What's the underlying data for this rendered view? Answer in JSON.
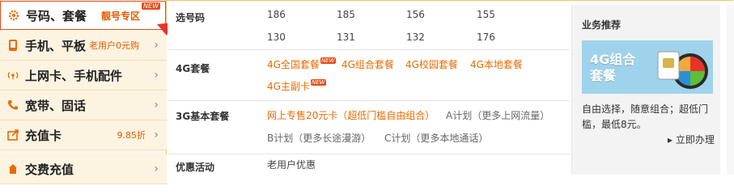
{
  "sidebar": {
    "items": [
      {
        "icon": "gear-icon",
        "label": "号码、套餐",
        "zone": "靓号专区",
        "badge": "NEW"
      },
      {
        "icon": "phone-icon",
        "label": "手机、平板",
        "sub": "老用户0元购"
      },
      {
        "icon": "signal-icon",
        "label": "上网卡、手机配件"
      },
      {
        "icon": "handset-icon",
        "label": "宽带、固话"
      },
      {
        "icon": "recharge-icon",
        "label": "充值卡",
        "sub": "9.85折"
      },
      {
        "icon": "payment-icon",
        "label": "交费充值"
      }
    ]
  },
  "main": {
    "sections": [
      {
        "title": "选号码",
        "items": [
          "186",
          "185",
          "156",
          "155",
          "130",
          "131",
          "132",
          "176"
        ]
      },
      {
        "title": "4G套餐",
        "items": [
          "4G全国套餐",
          "4G组合套餐",
          "4G校园套餐",
          "4G本地套餐",
          "4G主副卡"
        ],
        "new_badge": "NEW"
      },
      {
        "title": "3G基本套餐",
        "items": [
          "网上专售20元卡（超低门槛自由组合）",
          "A计划（更多上网流量）",
          "B计划（更多长途漫游）",
          "C计划（更多本地通话）"
        ]
      },
      {
        "title": "优惠活动",
        "items": [
          "老用户优惠"
        ]
      }
    ]
  },
  "promo": {
    "title": "业务推荐",
    "banner_text": "4G组合套餐",
    "description": "自由选择，随意组合；超低门槛，最低8元。",
    "link_label": "▸ 立即办理"
  },
  "colors": {
    "accent": "#e86b00",
    "active_border": "#e34c1a",
    "sidebar_bg": "#fdf3e1"
  }
}
